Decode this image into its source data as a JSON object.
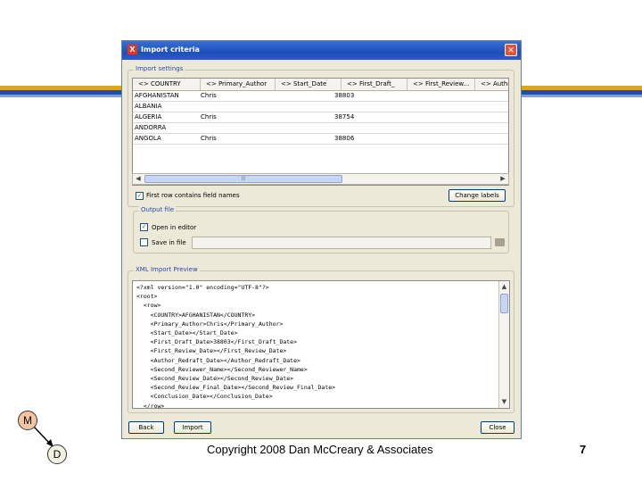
{
  "dialog": {
    "title": "Import criteria",
    "close_glyph": "✕"
  },
  "import_settings": {
    "title": "Import settings",
    "columns": [
      "<> COUNTRY",
      "<> Primary_Author",
      "<> Start_Date",
      "<> First_Draft_",
      "<> First_Review...",
      "<> Author_R"
    ],
    "rows": [
      [
        "AFGHANISTAN",
        "Chris",
        "",
        "38803"
      ],
      [
        "ALBANIA",
        "",
        "",
        ""
      ],
      [
        "ALGERIA",
        "Chris",
        "",
        "38754"
      ],
      [
        "ANDORRA",
        "",
        "",
        ""
      ],
      [
        "ANGOLA",
        "Chris",
        "",
        "38806"
      ]
    ],
    "first_row_label": "First row contains field names",
    "first_row_checked": true,
    "change_labels_button": "Change labels"
  },
  "output_file": {
    "title": "Output file",
    "open_in_editor_label": "Open in editor",
    "open_in_editor_checked": true,
    "save_in_file_label": "Save in file",
    "save_in_file_checked": false
  },
  "xml_preview": {
    "title": "XML Import Preview",
    "lines": [
      "<?xml version=\"1.0\" encoding=\"UTF-8\"?>",
      "<root>",
      "  <row>",
      "    <COUNTRY>AFGHANISTAN</COUNTRY>",
      "    <Primary_Author>Chris</Primary_Author>",
      "    <Start_Date></Start_Date>",
      "    <First_Draft_Date>38803</First_Draft_Date>",
      "    <First_Review_Date></First_Review_Date>",
      "    <Author_Redraft_Date></Author_Redraft_Date>",
      "    <Second_Reviewer_Name></Second_Reviewer_Name>",
      "    <Second_Review_Date></Second_Review_Date>",
      "    <Second_Review_Final_Date></Second_Review_Final_Date>",
      "    <Conclusion_Date></Conclusion_Date>",
      "  </row>"
    ]
  },
  "buttons": {
    "back": "Back",
    "import": "Import",
    "close": "Close"
  },
  "diagram": {
    "node_m": "M",
    "node_d": "D"
  },
  "footer": {
    "copyright": "Copyright 2008 Dan McCreary & Associates",
    "page_number": "7"
  }
}
